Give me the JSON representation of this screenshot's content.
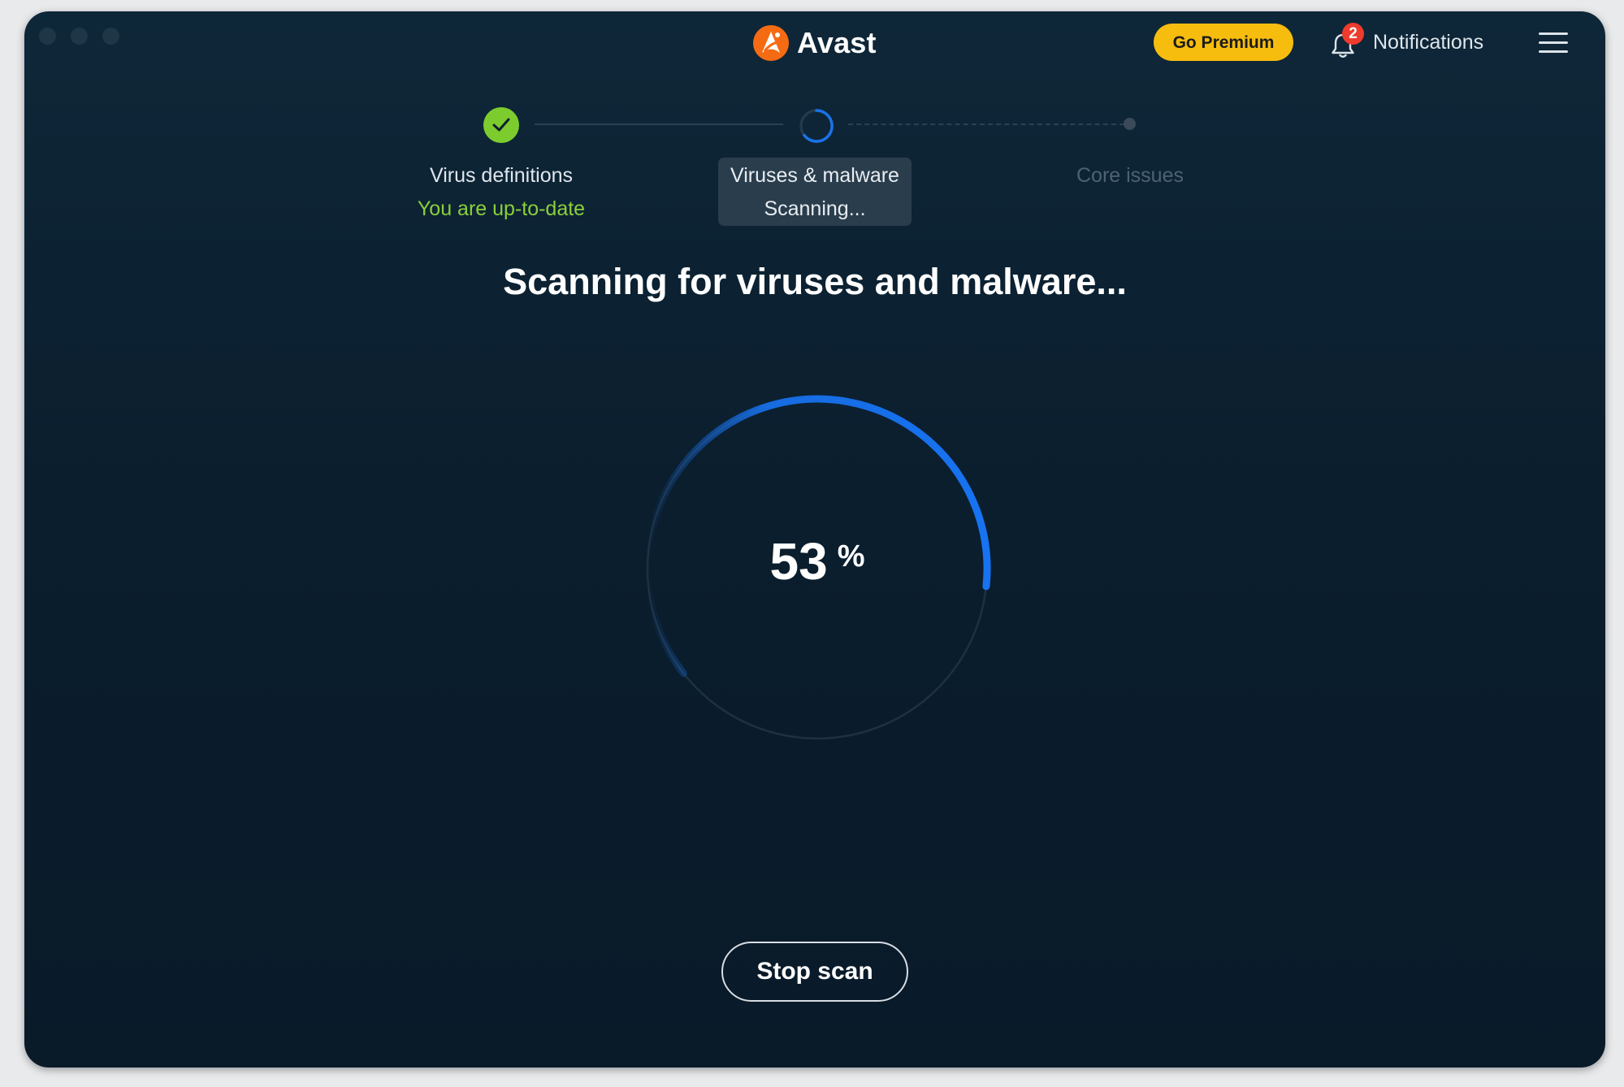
{
  "app": {
    "name": "Avast",
    "brand_color": "#f56b13"
  },
  "header": {
    "premium_label": "Go Premium",
    "premium_color": "#f7bd0e",
    "notifications_label": "Notifications",
    "notifications_count": "2",
    "badge_color": "#ee3b2d"
  },
  "steps": [
    {
      "title": "Virus definitions",
      "status": "You are up-to-date",
      "state": "done",
      "color": "#7dcc2e"
    },
    {
      "title": "Viruses & malware",
      "status": "Scanning...",
      "state": "active",
      "color": "#1a73e8"
    },
    {
      "title": "Core issues",
      "state": "pending"
    }
  ],
  "scan": {
    "heading": "Scanning for viruses and malware...",
    "progress_value": "53",
    "progress_unit": "%",
    "progress_fraction": 0.53,
    "accent_color": "#1773f2",
    "stop_label": "Stop scan"
  },
  "icons": {
    "logo": "avast-logo-icon",
    "bell": "bell-icon",
    "menu": "hamburger-menu-icon",
    "check": "check-icon",
    "spinner": "spinner-icon"
  }
}
